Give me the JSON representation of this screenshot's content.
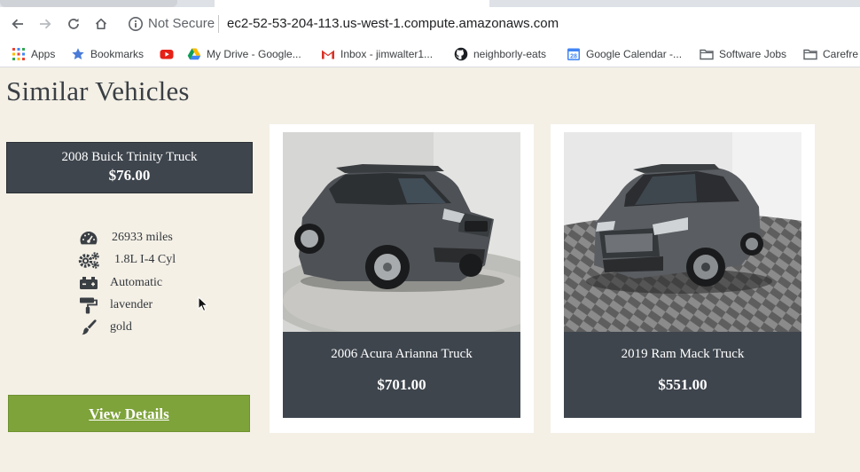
{
  "browser": {
    "security_label": "Not Secure",
    "url": "ec2-52-53-204-113.us-west-1.compute.amazonaws.com"
  },
  "bookmarks": [
    {
      "label": "Apps",
      "icon": "apps-grid-icon"
    },
    {
      "label": "Bookmarks",
      "icon": "star-icon"
    },
    {
      "label": "",
      "icon": "youtube-icon"
    },
    {
      "label": "My Drive - Google...",
      "icon": "google-drive-icon"
    },
    {
      "label": "Inbox - jimwalter1...",
      "icon": "gmail-icon"
    },
    {
      "label": "neighborly-eats",
      "icon": "github-icon"
    },
    {
      "label": "Google Calendar -...",
      "icon": "google-calendar-icon"
    },
    {
      "label": "Software Jobs",
      "icon": "folder-icon"
    },
    {
      "label": "Carefre",
      "icon": "folder-icon"
    }
  ],
  "page": {
    "title": "Similar Vehicles"
  },
  "featured": {
    "name": "2008 Buick Trinity Truck",
    "price": "$76.00",
    "specs": [
      {
        "icon": "speedometer-icon",
        "text": "26933 miles"
      },
      {
        "icon": "gears-icon",
        "text": "1.8L I-4 Cyl"
      },
      {
        "icon": "transmission-icon",
        "text": "Automatic"
      },
      {
        "icon": "paint-roller-icon",
        "text": "lavender"
      },
      {
        "icon": "paint-brush-icon",
        "text": "gold"
      }
    ],
    "button_label": "View Details"
  },
  "cards": [
    {
      "name": "2006 Acura Arianna Truck",
      "price": "$701.00",
      "photo": "gray-suv-photo"
    },
    {
      "name": "2019 Ram Mack Truck",
      "price": "$551.00",
      "photo": "gray-compact-suv-photo"
    }
  ],
  "colors": {
    "page_bg": "#f4f0e6",
    "panel_dark": "#3e454d",
    "button_green": "#7ea33a",
    "card_bg": "#ffffff"
  }
}
